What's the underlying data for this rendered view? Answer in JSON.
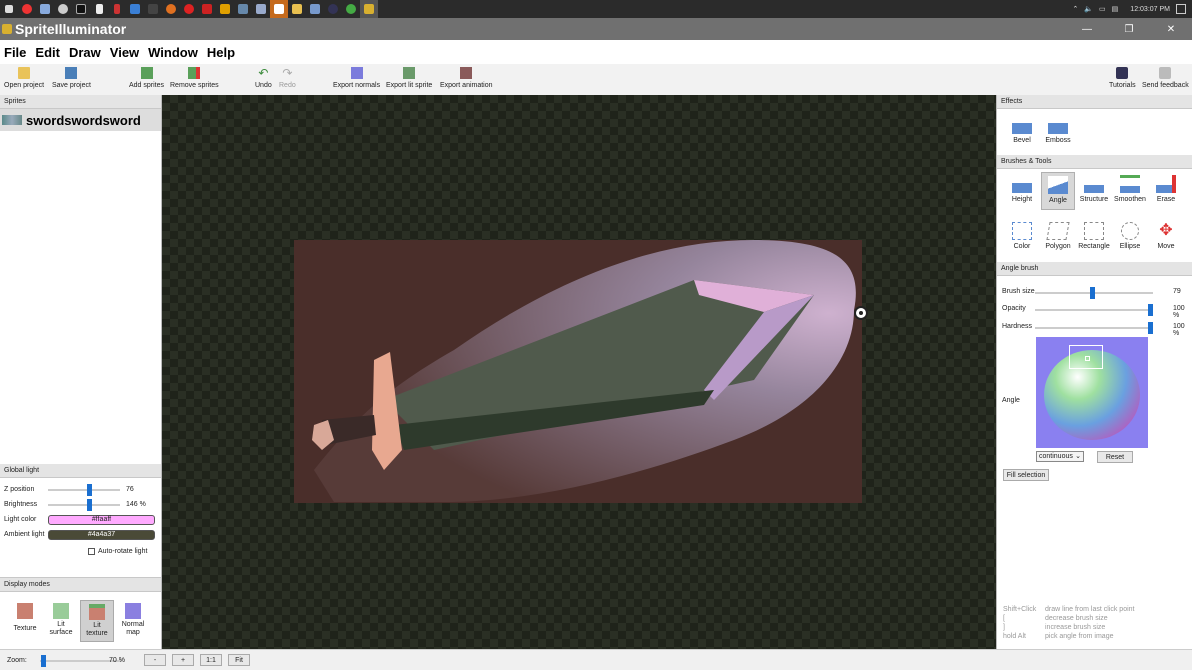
{
  "taskbar": {
    "icons": [
      "start-icon",
      "chrome-icon",
      "app-icon",
      "settings-icon",
      "cmd-icon",
      "notepad-icon",
      "file-icon",
      "wifi-icon",
      "bird-icon",
      "pumpkin-icon",
      "opera-icon",
      "video-icon",
      "ln-icon",
      "remote-icon",
      "image-icon",
      "cast-icon",
      "folder-icon",
      "network-icon",
      "steam-icon",
      "palette-icon",
      "sprite-icon"
    ],
    "clock": "12:03:07 PM"
  },
  "window": {
    "title": "SpriteIlluminator",
    "minimize": "—",
    "restore": "❐",
    "close": "✕"
  },
  "menu": [
    "File",
    "Edit",
    "Draw",
    "View",
    "Window",
    "Help"
  ],
  "toolbar": {
    "open_project": "Open project",
    "save_project": "Save project",
    "add_sprites": "Add sprites",
    "remove_sprites": "Remove sprites",
    "undo": "Undo",
    "redo": "Redo",
    "export_normals": "Export normals",
    "export_lit_sprite": "Export lit sprite",
    "export_animation": "Export animation",
    "tutorials": "Tutorials",
    "send_feedback": "Send feedback"
  },
  "sprites": {
    "header": "Sprites",
    "items": [
      "swordswordsword"
    ]
  },
  "global_light": {
    "header": "Global light",
    "z_position_label": "Z position",
    "z_position_value": "76",
    "brightness_label": "Brightness",
    "brightness_value": "146 %",
    "light_color_label": "Light color",
    "light_color_value": "#ffaaff",
    "ambient_light_label": "Ambient light",
    "ambient_light_value": "#4a4a37",
    "auto_rotate_label": "Auto-rotate light",
    "auto_rotate_checked": false
  },
  "display_modes": {
    "header": "Display modes",
    "items": [
      {
        "label1": "Texture",
        "label2": ""
      },
      {
        "label1": "Lit",
        "label2": "surface"
      },
      {
        "label1": "Lit",
        "label2": "texture"
      },
      {
        "label1": "Normal",
        "label2": "map"
      }
    ],
    "selected": 2
  },
  "effects": {
    "header": "Effects",
    "bevel": "Bevel",
    "emboss": "Emboss"
  },
  "brushes": {
    "header": "Brushes & Tools",
    "height": "Height",
    "angle": "Angle",
    "structure": "Structure",
    "smoothen": "Smoothen",
    "erase": "Erase",
    "color": "Color",
    "polygon": "Polygon",
    "rectangle": "Rectangle",
    "ellipse": "Ellipse",
    "move": "Move",
    "selected": "angle"
  },
  "angle_brush": {
    "header": "Angle brush",
    "brush_size_label": "Brush size",
    "brush_size_value": "79",
    "opacity_label": "Opacity",
    "opacity_value": "100 %",
    "hardness_label": "Hardness",
    "hardness_value": "100 %",
    "angle_label": "Angle",
    "mode_value": "continuous",
    "reset": "Reset",
    "fill_selection": "Fill selection"
  },
  "hints": [
    {
      "key": "Shift+Click",
      "desc": "draw line from last click point"
    },
    {
      "key": "[",
      "desc": "decrease brush size"
    },
    {
      "key": "]",
      "desc": "increase brush size"
    },
    {
      "key": "hold Alt",
      "desc": "pick angle from image"
    }
  ],
  "status": {
    "zoom_label": "Zoom:",
    "zoom_value": "70 %",
    "minus": "-",
    "plus": "+",
    "one_to_one": "1:1",
    "fit": "Fit"
  },
  "colors": {
    "light": "#ffaaff",
    "ambient": "#4a4a37",
    "accent": "#1a6fd0"
  }
}
